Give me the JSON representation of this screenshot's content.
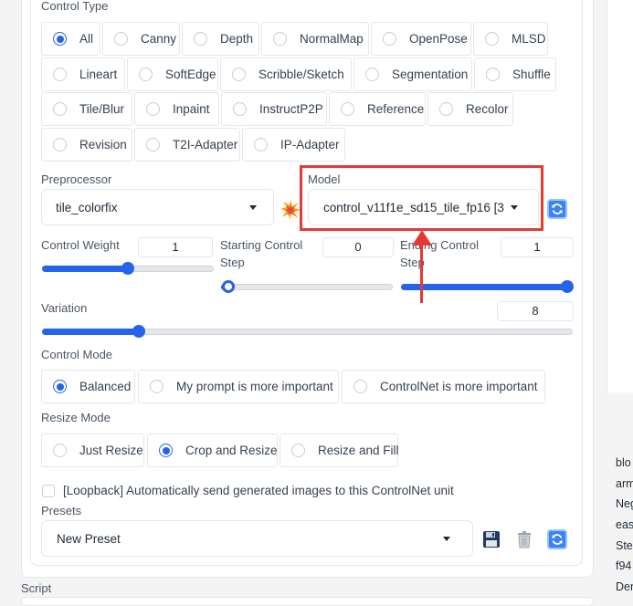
{
  "control_type": {
    "label": "Control Type",
    "options": [
      "All",
      "Canny",
      "Depth",
      "NormalMap",
      "OpenPose",
      "MLSD",
      "Lineart",
      "SoftEdge",
      "Scribble/Sketch",
      "Segmentation",
      "Shuffle",
      "Tile/Blur",
      "Inpaint",
      "InstructP2P",
      "Reference",
      "Recolor",
      "Revision",
      "T2I-Adapter",
      "IP-Adapter"
    ],
    "selected": "All"
  },
  "preprocessor": {
    "label": "Preprocessor",
    "value": "tile_colorfix"
  },
  "model": {
    "label": "Model",
    "value": "control_v11f1e_sd15_tile_fp16 [3"
  },
  "control_weight": {
    "label": "Control Weight",
    "value": "1",
    "fraction": 0.47
  },
  "starting_step": {
    "label_line1": "Starting Control",
    "label_line2": "Step",
    "value": "0",
    "fraction": 0.0
  },
  "ending_step": {
    "label_line1": "Ending Control",
    "label_line2": "Step",
    "value": "1",
    "fraction": 1.0
  },
  "variation": {
    "label": "Variation",
    "value": "8",
    "fraction": 0.18
  },
  "control_mode": {
    "label": "Control Mode",
    "options": [
      "Balanced",
      "My prompt is more important",
      "ControlNet is more important"
    ],
    "selected": "Balanced"
  },
  "resize_mode": {
    "label": "Resize Mode",
    "options": [
      "Just Resize",
      "Crop and Resize",
      "Resize and Fill"
    ],
    "selected": "Crop and Resize"
  },
  "loopback": {
    "label": "[Loopback] Automatically send generated images to this ControlNet unit",
    "checked": false
  },
  "presets": {
    "label": "Presets",
    "value": "New Preset"
  },
  "script": {
    "label": "Script"
  },
  "side_panel": {
    "lines": [
      "blo",
      "arm",
      "Neg",
      "eas",
      "Ste",
      "f94",
      "Der"
    ]
  },
  "annotation": {
    "color": "#e53935"
  },
  "colors": {
    "accent": "#2563eb"
  }
}
